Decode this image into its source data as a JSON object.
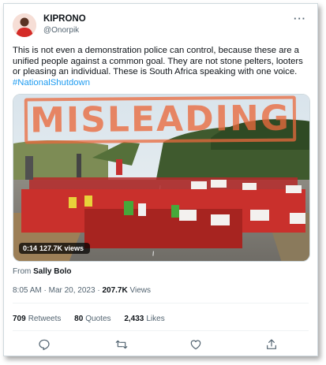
{
  "author": {
    "name": "KIPRONO",
    "handle": "@Onorpik"
  },
  "tweet": {
    "text": "This is not even a demonstration police can control, because these are a unified people against a common goal. They are not stone pelters, looters or pleasing an individual. These is South Africa speaking with one voice. ",
    "hashtag": "#NationalShutdown"
  },
  "media": {
    "overlay_label": "MISLEADING",
    "duration": "0:14",
    "views": "127.7K views"
  },
  "from": {
    "prefix": "From",
    "source": "Sally Bolo"
  },
  "meta": {
    "time": "8:05 AM",
    "dot": "·",
    "date": "Mar 20, 2023",
    "views_count": "207.7K",
    "views_label": "Views"
  },
  "stats": {
    "retweets_count": "709",
    "retweets_label": "Retweets",
    "quotes_count": "80",
    "quotes_label": "Quotes",
    "likes_count": "2,433",
    "likes_label": "Likes"
  },
  "actions": [
    "reply-icon",
    "retweet-icon",
    "like-icon",
    "share-icon"
  ],
  "colors": {
    "link": "#1d9bf0",
    "stamp": "#e9693c",
    "text": "#0f1419",
    "muted": "#536471"
  }
}
